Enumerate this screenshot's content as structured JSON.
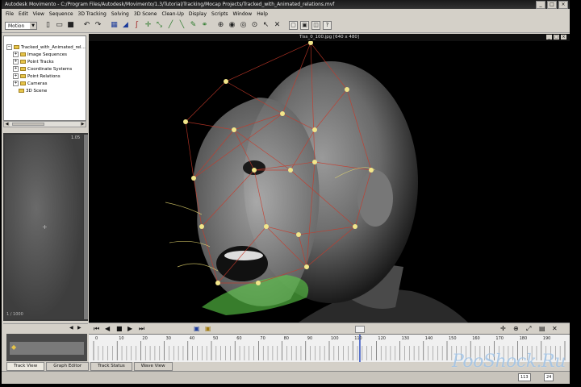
{
  "window": {
    "title": "Autodesk Movimento - C:/Program Files/Autodesk/Movimento/1.3/Tutorial/Tracking/Mocap Projects/Tracked_with_Animated_relations.mvf",
    "minimize": "_",
    "maximize": "□",
    "close": "×"
  },
  "menu": [
    "File",
    "Edit",
    "View",
    "Sequence",
    "3D Tracking",
    "Solving",
    "3D Scene",
    "Clean-Up",
    "Display",
    "Scripts",
    "Window",
    "Help"
  ],
  "toolbar": {
    "mode_value": "Motion",
    "tools": [
      {
        "icon": "new-file-icon",
        "glyph": "▯"
      },
      {
        "icon": "open-folder-icon",
        "glyph": "▭"
      },
      {
        "icon": "save-icon",
        "glyph": "■"
      },
      {
        "icon": "undo-icon",
        "glyph": "↶"
      },
      {
        "icon": "redo-icon",
        "glyph": "↷"
      },
      {
        "icon": "film-icon",
        "glyph": "▦"
      },
      {
        "icon": "track-icon",
        "glyph": "◢"
      },
      {
        "icon": "curve-icon",
        "glyph": "ʃ"
      },
      {
        "icon": "move-icon",
        "glyph": "✛"
      },
      {
        "icon": "scale-icon",
        "glyph": "⤡"
      },
      {
        "icon": "line-tool-icon",
        "glyph": "╱"
      },
      {
        "icon": "line-tool-2-icon",
        "glyph": "╲"
      },
      {
        "icon": "pen-icon",
        "glyph": "✎"
      },
      {
        "icon": "link-icon",
        "glyph": "⚭"
      },
      {
        "icon": "solve-icon",
        "glyph": "⊕"
      },
      {
        "icon": "camera-icon",
        "glyph": "◉"
      },
      {
        "icon": "view-icon",
        "glyph": "◎"
      },
      {
        "icon": "zoom-icon",
        "glyph": "⊙"
      },
      {
        "icon": "select-icon",
        "glyph": "↖"
      },
      {
        "icon": "cross-icon",
        "glyph": "✕"
      },
      {
        "icon": "layout-1-icon",
        "glyph": "▢"
      },
      {
        "icon": "layout-2-icon",
        "glyph": "▣"
      },
      {
        "icon": "layout-3-icon",
        "glyph": "◫"
      },
      {
        "icon": "help-icon",
        "glyph": "?"
      }
    ]
  },
  "tree": {
    "root": "Tracked_with_Animated_rel...",
    "items": [
      "Image Sequences",
      "Point Tracks",
      "Coordinate Systems",
      "Point Relations",
      "Cameras",
      "3D Scene"
    ]
  },
  "preview": {
    "frame_label": "1.05",
    "bottom_label": "1 / 1000"
  },
  "viewport": {
    "title": "Tiss_0_100.jpg [640 x 480]"
  },
  "timeline": {
    "ruler_labels": [
      "0",
      "10",
      "20",
      "30",
      "40",
      "50",
      "60",
      "70",
      "80",
      "90",
      "100",
      "110",
      "120",
      "130",
      "140",
      "150",
      "160",
      "170",
      "180",
      "190"
    ],
    "current_frame": "113",
    "fps": "24",
    "tabs": [
      "Track View",
      "Graph Editor",
      "Track Status",
      "Wave View"
    ]
  },
  "watermark": "PooShock.Ru",
  "colors": {
    "mesh_red": "#c83a2a",
    "marker_yellow": "#f2e68a",
    "highlight_green": "#5ed04a",
    "ui_grey": "#d4d0c8"
  }
}
